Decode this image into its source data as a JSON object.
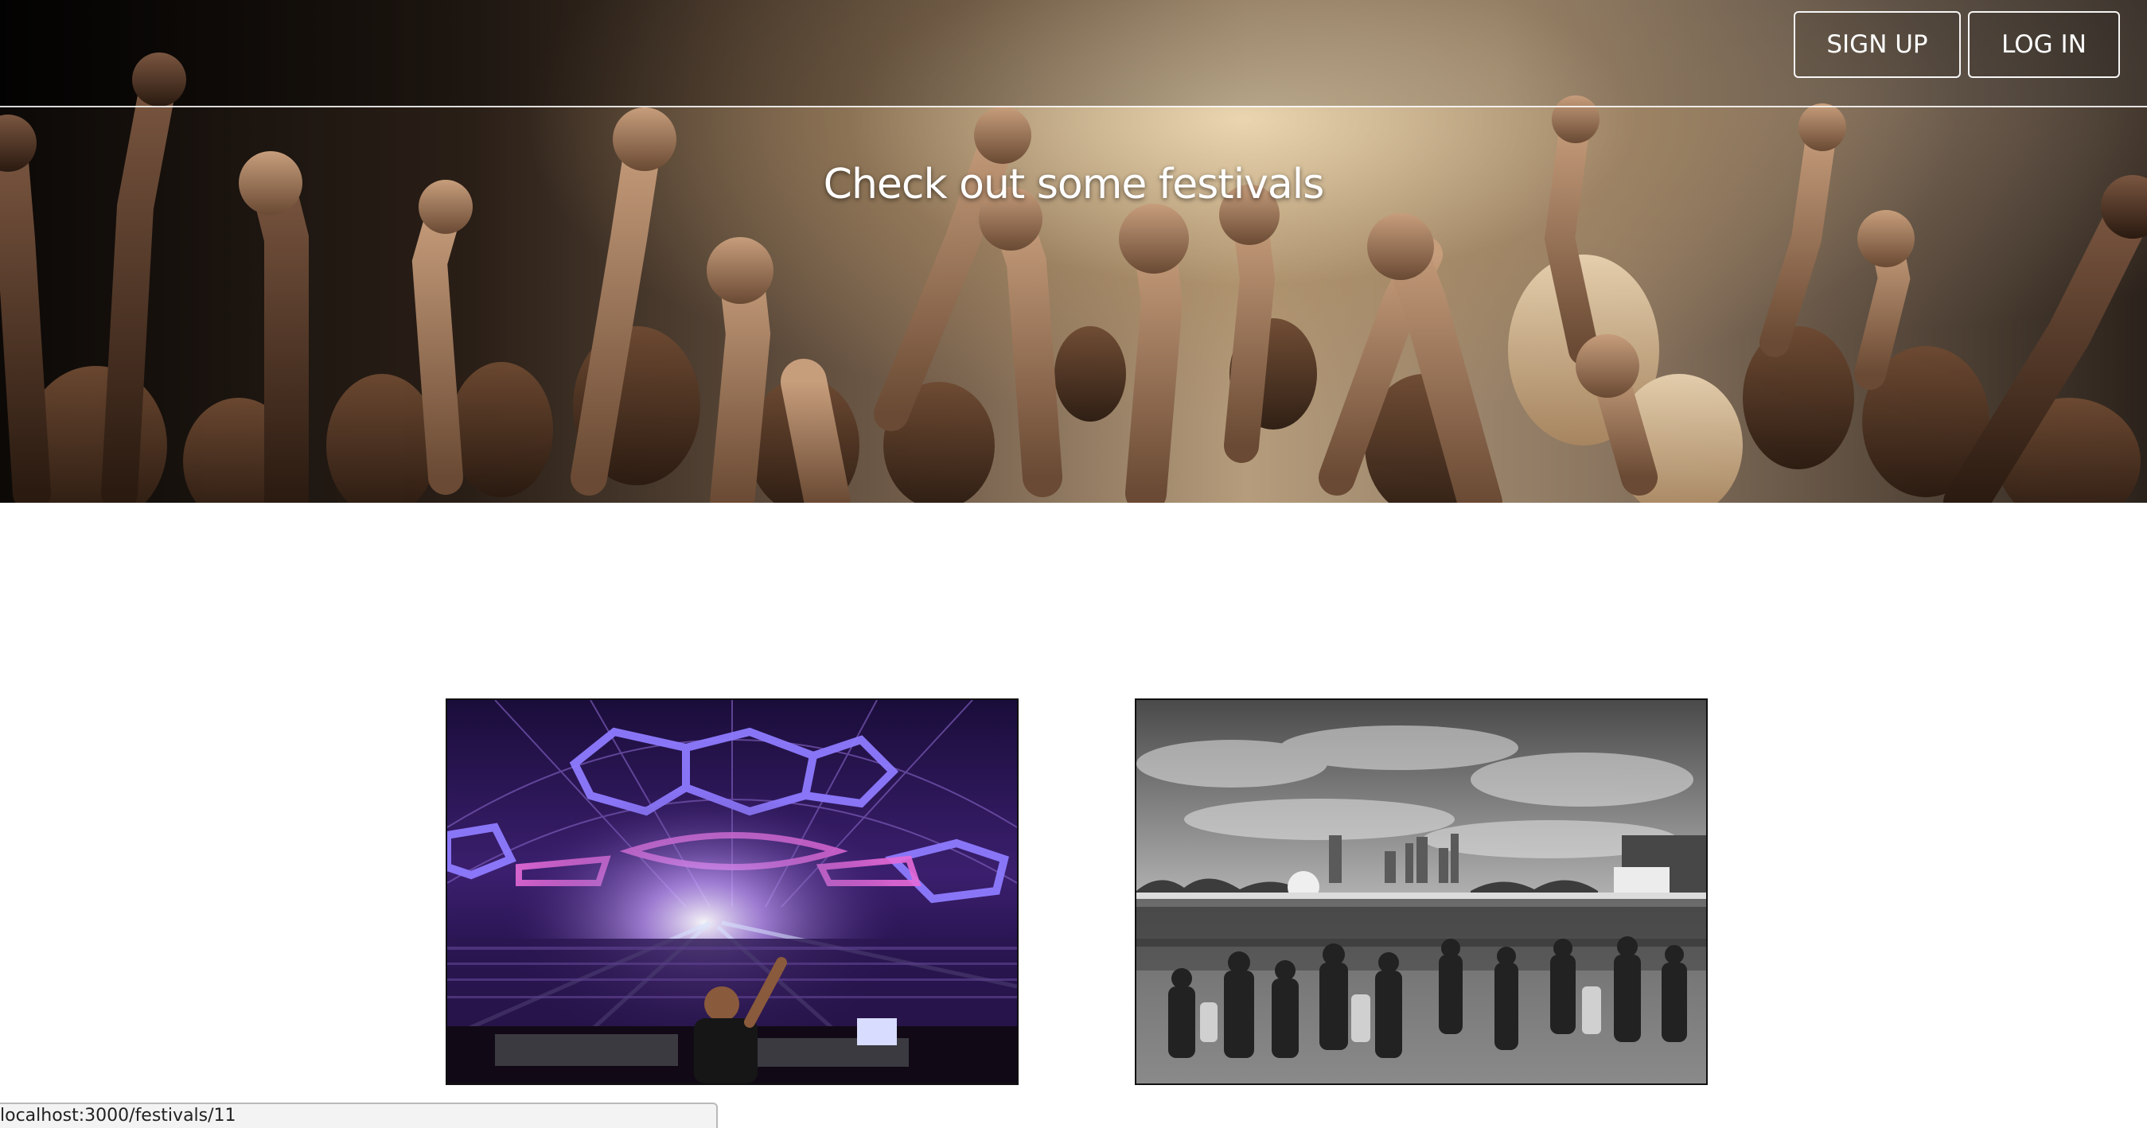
{
  "header": {
    "signup_label": "SIGN UP",
    "login_label": "LOG IN"
  },
  "hero": {
    "title": "Check out some festivals",
    "background_image": "concert-crowd-hands-raised"
  },
  "festivals": [
    {
      "image": "edm-arena-light-show-dj"
    },
    {
      "image": "black-white-outdoor-festival-crowd-city-skyline"
    }
  ],
  "status_bar": {
    "url": "localhost:3000/festivals/11"
  },
  "colors": {
    "hero_warm_light": "#ecd8b2",
    "hero_dark": "#0c0907",
    "button_border": "#ffffff",
    "card_border": "#111111",
    "status_bar_bg": "#f3f3f3"
  }
}
